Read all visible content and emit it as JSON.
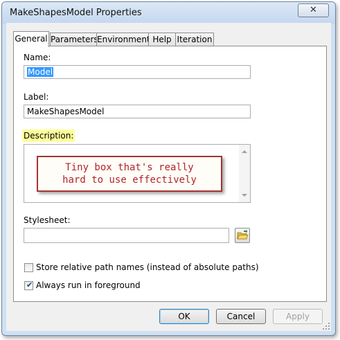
{
  "window": {
    "title": "MakeShapesModel Properties",
    "close_glyph": "✕"
  },
  "tabs": [
    {
      "label": "General",
      "active": true
    },
    {
      "label": "Parameters"
    },
    {
      "label": "Environments"
    },
    {
      "label": "Help"
    },
    {
      "label": "Iteration"
    }
  ],
  "general": {
    "name_label": "Name:",
    "name_value": "Model",
    "label_label": "Label:",
    "label_value": "MakeShapesModel",
    "description_label": "Description:",
    "description_value": "",
    "stylesheet_label": "Stylesheet:",
    "stylesheet_value": "",
    "browse_icon": "folder-open-icon",
    "store_relative_label": "Store relative path names (instead of absolute paths)",
    "store_relative_checked": false,
    "always_foreground_label": "Always run in foreground",
    "always_foreground_checked": true
  },
  "annotation": {
    "line1": "Tiny box that's really",
    "line2": "hard to use effectively"
  },
  "buttons": {
    "ok": "OK",
    "cancel": "Cancel",
    "apply": "Apply"
  },
  "colors": {
    "highlight": "#fefe9c",
    "selection": "#3399ff",
    "callout_border": "#a33434",
    "callout_text": "#b0242a"
  }
}
